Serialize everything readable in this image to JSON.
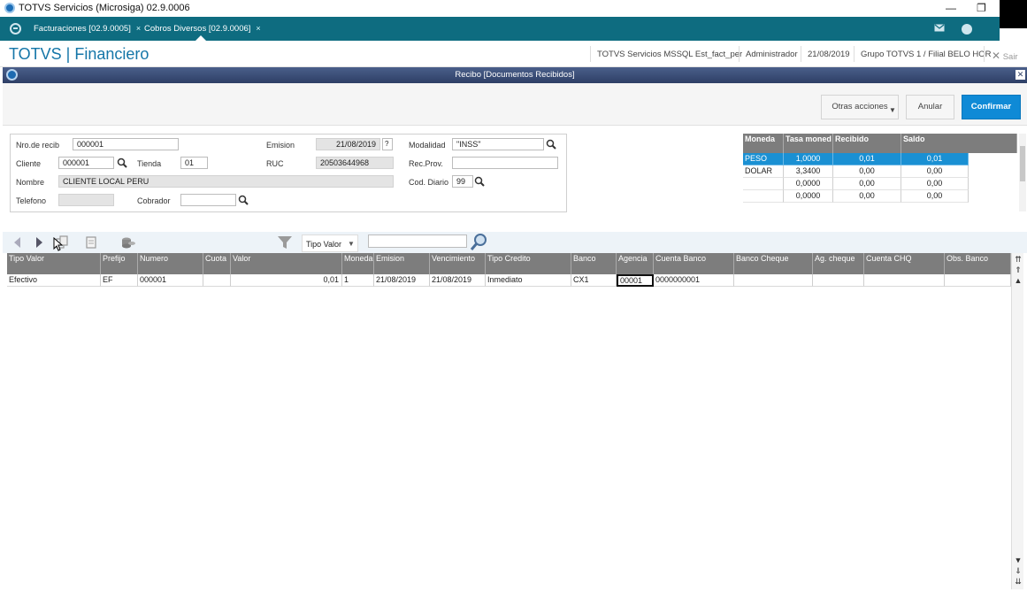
{
  "window": {
    "title": "TOTVS Servicios (Microsiga) 02.9.0006",
    "minimize": "—",
    "restore": "❐"
  },
  "tabs": [
    {
      "label": "Facturaciones [02.9.0005]",
      "close": "×"
    },
    {
      "label": "Cobros Diversos [02.9.0006]",
      "close": "×"
    }
  ],
  "header": {
    "app_title": "TOTVS | Financiero",
    "environment": "TOTVS Servicios MSSQL Est_fact_per",
    "user": "Administrador",
    "date": "21/08/2019",
    "branch": "Grupo TOTVS 1 / Filial BELO HOR",
    "exit_label": "Sair",
    "help_icon": "?"
  },
  "dialog": {
    "title": "Recibo [Documentos Recibidos]"
  },
  "actions": {
    "other_actions": "Otras acciones",
    "cancel": "Anular",
    "confirm": "Confirmar"
  },
  "form": {
    "nro_recib_label": "Nro.de recib",
    "nro_recib": "000001",
    "cliente_label": "Cliente",
    "cliente": "000001",
    "tienda_label": "Tienda",
    "tienda": "01",
    "nombre_label": "Nombre",
    "nombre": "CLIENTE LOCAL PERU",
    "telefono_label": "Telefono",
    "telefono": "",
    "cobrador_label": "Cobrador",
    "cobrador": "",
    "emision_label": "Emision",
    "emision": "21/08/2019",
    "emision_help": "?",
    "ruc_label": "RUC",
    "ruc": "20503644968",
    "modalidad_label": "Modalidad",
    "modalidad": "\"INSS\"",
    "rec_prov_label": "Rec.Prov.",
    "rec_prov": "",
    "cod_diario_label": "Cod. Diario",
    "cod_diario": "99"
  },
  "currency_grid": {
    "headers": [
      "Moneda",
      "Tasa moned",
      "Recibido",
      "Saldo"
    ],
    "rows": [
      {
        "moneda": "PESO",
        "tasa": "1,0000",
        "recibido": "0,01",
        "saldo": "0,01"
      },
      {
        "moneda": "DOLAR",
        "tasa": "3,3400",
        "recibido": "0,00",
        "saldo": "0,00"
      },
      {
        "moneda": "",
        "tasa": "0,0000",
        "recibido": "0,00",
        "saldo": "0,00"
      },
      {
        "moneda": "",
        "tasa": "0,0000",
        "recibido": "0,00",
        "saldo": "0,00"
      }
    ]
  },
  "toolbar": {
    "filter_select": "Tipo Valor",
    "search_value": ""
  },
  "main_grid": {
    "headers": [
      "Tipo Valor",
      "Prefijo",
      "Numero",
      "Cuota",
      "Valor",
      "Moneda",
      "Emision",
      "Vencimiento",
      "Tipo Credito",
      "Banco",
      "Agencia",
      "Cuenta Banco",
      "Banco Cheque",
      "Ag. cheque",
      "Cuenta CHQ",
      "Obs. Banco"
    ],
    "rows": [
      [
        "Efectivo",
        "EF",
        "000001",
        "",
        "0,01",
        "1",
        "21/08/2019",
        "21/08/2019",
        "Inmediato",
        "CX1",
        "00001",
        "0000000001",
        "",
        "",
        "",
        ""
      ]
    ]
  },
  "colors": {
    "tab_bar": "#0e6c80",
    "brand_title": "#1576a8",
    "confirm_button": "#0f8ad6",
    "grid_header": "#7d7d7d",
    "selected_row": "#1a90d3"
  },
  "icons": [
    "totvs-logo-icon",
    "home-icon",
    "mail-icon",
    "help-icon",
    "close-icon",
    "search-icon",
    "filter-icon",
    "arrow-left-icon",
    "arrow-right-icon",
    "copy-icon",
    "paste-icon",
    "coins-icon",
    "dropdown-arrow-icon"
  ]
}
